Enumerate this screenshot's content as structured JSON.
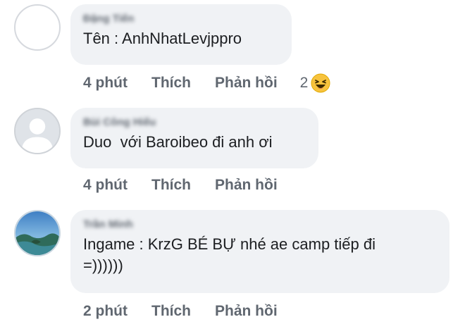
{
  "comments": [
    {
      "author": "Đặng Tiến",
      "text": "Tên : AnhNhatLevjppro",
      "time": "4 phút",
      "like_label": "Thích",
      "reply_label": "Phản hồi",
      "reaction_count": "2",
      "reaction_icon": "haha-emoji"
    },
    {
      "author": "Bùi Công Hiếu",
      "text": "Duo  với Baroibeo đi anh ơi",
      "time": "4 phút",
      "like_label": "Thích",
      "reply_label": "Phản hồi"
    },
    {
      "author": "Trần Minh",
      "text": "Ingame : KrzG BÉ BỰ nhé ae camp tiếp đi\n=))))))",
      "time": "2 phút",
      "like_label": "Thích",
      "reply_label": "Phản hồi"
    }
  ],
  "colors": {
    "bubble": "#f0f2f5",
    "meta_text": "#606770",
    "body_text": "#1c1e21",
    "haha_yellow": "#f7c33e"
  }
}
